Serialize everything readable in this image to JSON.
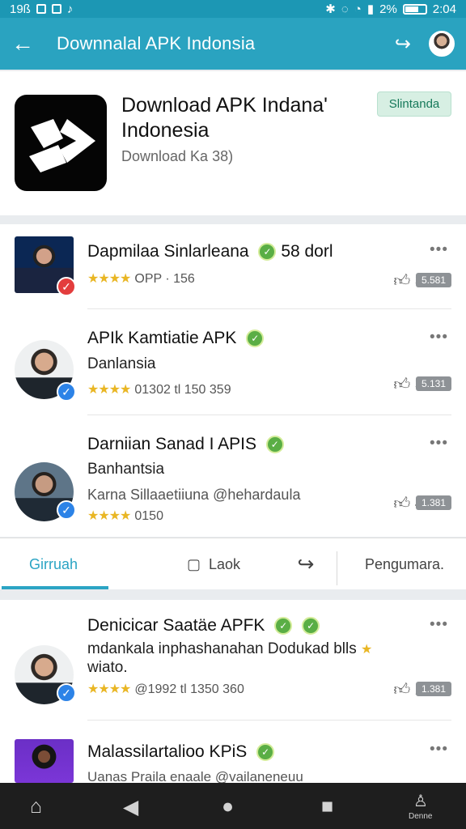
{
  "status": {
    "left": "19ß",
    "time": "2:04",
    "battery": "2%"
  },
  "appbar": {
    "title": "Downnalal APK Indonsia"
  },
  "app": {
    "title": "Download APK Indana' Indonesia",
    "subtitle": "Download Ka 38)",
    "badge": "Slintanda"
  },
  "items": [
    {
      "name": "Dapmilaa Sinlarleana",
      "extra": "58 dorl",
      "meta": "OPP · 156",
      "likes": "3",
      "count": "5.581"
    },
    {
      "name": "APIk Kamtiatie APK",
      "line": "Danlansia",
      "meta": "01302 tl 150   359",
      "likes": "3",
      "count": "5.131"
    },
    {
      "name": "Darniian Sanad I APIS",
      "line": "Banhantsia",
      "meta_line": "Karna Sillaaetiiuna @hehardaula",
      "meta": "0150",
      "likes": "4",
      "count": "1.381"
    }
  ],
  "tabs": [
    {
      "label": "Girruah"
    },
    {
      "label": "Laok"
    },
    {
      "label": "Pengumara."
    }
  ],
  "feed": [
    {
      "name": "Denicicar Saatäe APFK",
      "line": "mdankala inphashanahan Dodukad blls",
      "line2": "wiato.",
      "meta": "@1992 tl 1350 360",
      "likes": "2",
      "count": "1.381"
    },
    {
      "name": "Malassilartalioo KPiS",
      "line": "Uanas Praila enaale @vailaneneuu"
    }
  ],
  "navbar": {
    "label": "Denne"
  },
  "colors": {
    "primary": "#2aa3c0",
    "status": "#1c97b4",
    "active": "#2ba4c4",
    "star": "#e9b624"
  }
}
